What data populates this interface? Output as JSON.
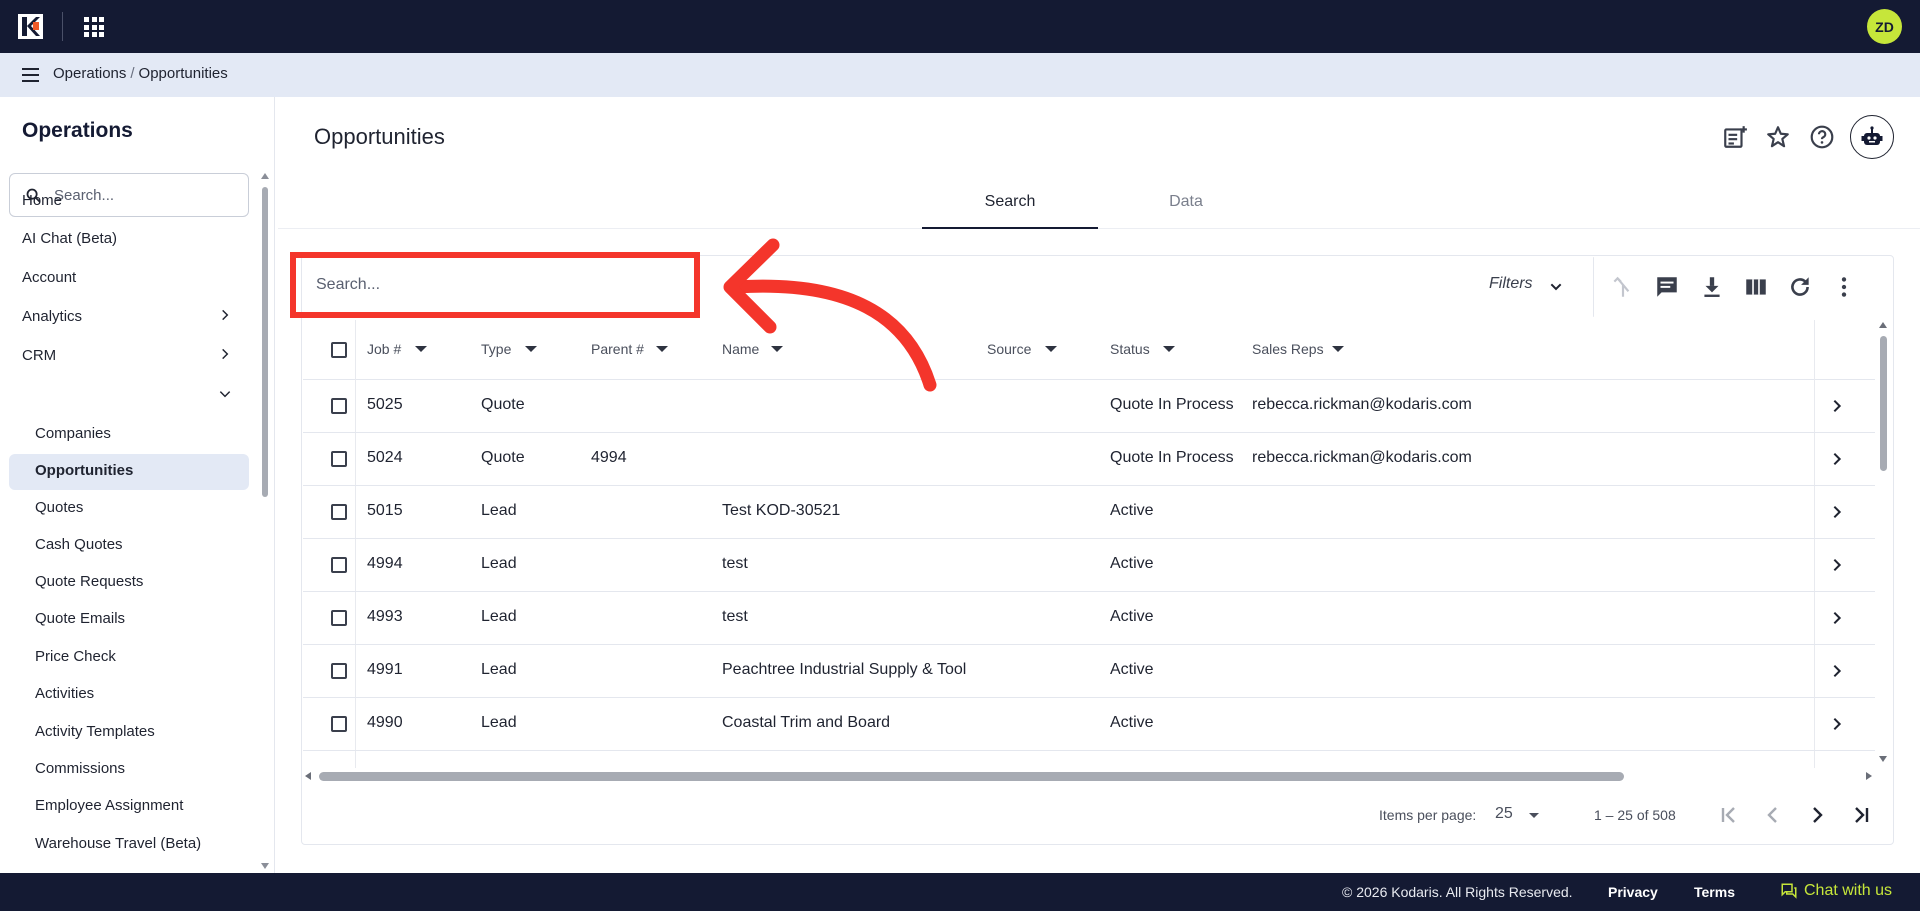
{
  "topbar": {
    "avatar_initials": "ZD"
  },
  "breadcrumb": {
    "root": "Operations",
    "separator": "/",
    "current": "Opportunities"
  },
  "sidebar": {
    "title": "Operations",
    "search_placeholder": "Search...",
    "items": [
      {
        "label": "Home"
      },
      {
        "label": "AI Chat (Beta)"
      },
      {
        "label": "Account"
      },
      {
        "label": "Analytics"
      },
      {
        "label": "CRM"
      },
      {
        "label": "Companies"
      },
      {
        "label": "Opportunities"
      },
      {
        "label": "Quotes"
      },
      {
        "label": "Cash Quotes"
      },
      {
        "label": "Quote Requests"
      },
      {
        "label": "Quote Emails"
      },
      {
        "label": "Price Check"
      },
      {
        "label": "Activities"
      },
      {
        "label": "Activity Templates"
      },
      {
        "label": "Commissions"
      },
      {
        "label": "Employee Assignment"
      },
      {
        "label": "Warehouse Travel (Beta)"
      }
    ]
  },
  "page": {
    "title": "Opportunities"
  },
  "tabs": [
    {
      "label": "Search"
    },
    {
      "label": "Data"
    }
  ],
  "toolbar": {
    "search_placeholder": "Search...",
    "filters_label": "Filters"
  },
  "grid": {
    "columns": [
      "Job #",
      "Type",
      "Parent #",
      "Name",
      "Source",
      "Status",
      "Sales Reps"
    ],
    "rows": [
      {
        "job": "5025",
        "type": "Quote",
        "parent": "",
        "name": "",
        "source": "",
        "status": "Quote In Process",
        "reps": "rebecca.rickman@kodaris.com"
      },
      {
        "job": "5024",
        "type": "Quote",
        "parent": "4994",
        "name": "",
        "source": "",
        "status": "Quote In Process",
        "reps": "rebecca.rickman@kodaris.com"
      },
      {
        "job": "5015",
        "type": "Lead",
        "parent": "",
        "name": "Test KOD-30521",
        "source": "",
        "status": "Active",
        "reps": ""
      },
      {
        "job": "4994",
        "type": "Lead",
        "parent": "",
        "name": "test",
        "source": "",
        "status": "Active",
        "reps": ""
      },
      {
        "job": "4993",
        "type": "Lead",
        "parent": "",
        "name": "test",
        "source": "",
        "status": "Active",
        "reps": ""
      },
      {
        "job": "4991",
        "type": "Lead",
        "parent": "",
        "name": "Peachtree Industrial Supply & Tool",
        "source": "",
        "status": "Active",
        "reps": ""
      },
      {
        "job": "4990",
        "type": "Lead",
        "parent": "",
        "name": "Coastal Trim and Board",
        "source": "",
        "status": "Active",
        "reps": ""
      }
    ]
  },
  "pager": {
    "items_per_page_label": "Items per page:",
    "items_per_page": "25",
    "range": "1 – 25 of 508"
  },
  "footer": {
    "copyright": "© 2026 Kodaris. All Rights Reserved.",
    "privacy": "Privacy",
    "terms": "Terms",
    "chat": "Chat with us"
  },
  "colors": {
    "navy": "#141a33",
    "accent_lime": "#c6e63a",
    "highlight_red": "#f4352b",
    "breadcrumb_bg": "#e3e9f5"
  }
}
